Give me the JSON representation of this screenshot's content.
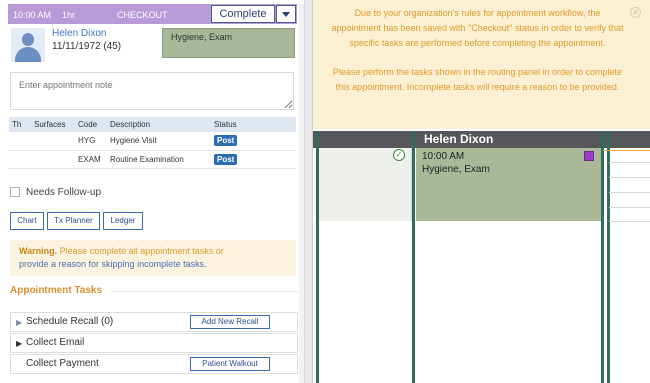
{
  "header": {
    "time": "10:00 AM",
    "duration": "1hr",
    "status": "CHECKOUT",
    "complete_label": "Complete"
  },
  "patient": {
    "name": "Helen Dixon",
    "dob_age": "11/11/1972 (45)",
    "procedures_summary": "Hygiene, Exam"
  },
  "note": {
    "placeholder": "Enter appointment note"
  },
  "procedure_table": {
    "headers": [
      "Th",
      "Surfaces",
      "Code",
      "Description",
      "Status"
    ],
    "rows": [
      {
        "th": "",
        "surfaces": "",
        "code": "HYG",
        "description": "Hygiene Visit",
        "status": "Post"
      },
      {
        "th": "",
        "surfaces": "",
        "code": "EXAM",
        "description": "Routine Examination",
        "status": "Post"
      }
    ]
  },
  "followup": {
    "label": "Needs Follow-up"
  },
  "buttons": {
    "chart": "Chart",
    "tx_planner": "Tx Planner",
    "ledger": "Ledger"
  },
  "warning": {
    "bold": "Warning.",
    "text": " Please complete all appointment tasks or",
    "line2": "provide a reason for skipping incomplete tasks."
  },
  "tasks": {
    "title": "Appointment Tasks",
    "items": [
      {
        "label": "Schedule Recall (0)",
        "button": "Add New Recall"
      },
      {
        "label": "Collect Email",
        "button": ""
      },
      {
        "label": "Collect Payment",
        "button": "Patient Walkout"
      }
    ]
  },
  "schedule": {
    "appointment": {
      "patient_name": "Helen Dixon",
      "time": "10:00 AM",
      "description": "Hygiene, Exam"
    }
  },
  "toast": {
    "paragraph1": "Due to your organization's rules for appointment workflow, the appointment has been saved with \"Checkout\" status in order to verify that specific tasks are performed before completing the appointment.",
    "paragraph2": "Please perform the tasks shown in the routing panel in order to complete this appointment. Incomplete tasks will require a reason to be provided."
  },
  "colors": {
    "header_purple": "#b89ad8",
    "appointment_green": "#a9b998",
    "warning_orange": "#d99a2b",
    "post_blue": "#2a6db0",
    "status_purple": "#9b3fc8"
  },
  "icons": {
    "avatar": "user-avatar-icon",
    "complete_dropdown": "chevron-down-icon",
    "confirmed": "check-circle-icon",
    "toast_close": "close-icon",
    "task_expand": "caret-right-icon"
  }
}
